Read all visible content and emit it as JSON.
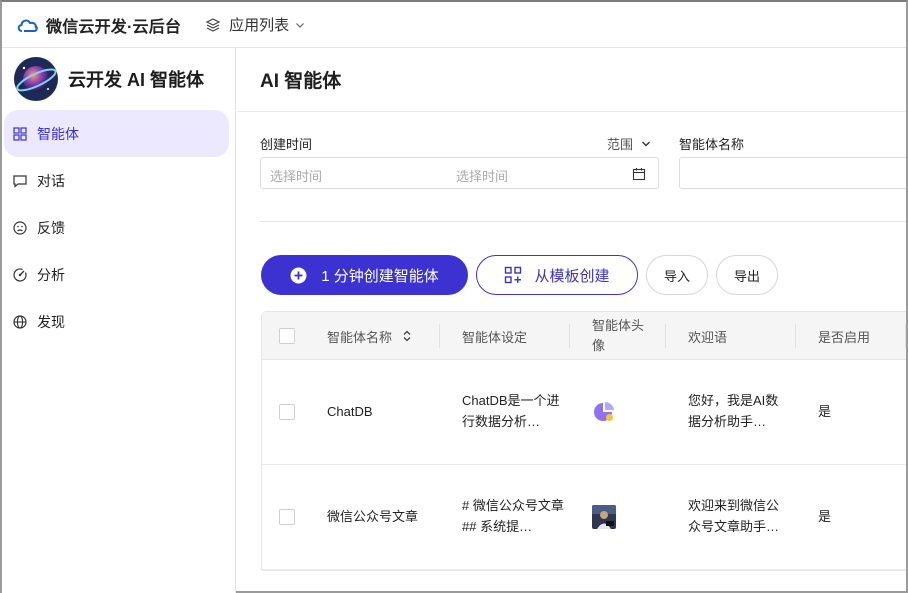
{
  "topbar": {
    "brand": "微信云开发·云后台",
    "app_list": "应用列表"
  },
  "sidebar": {
    "title": "云开发 AI 智能体",
    "items": [
      {
        "label": "智能体",
        "icon": "grid-icon",
        "active": true
      },
      {
        "label": "对话",
        "icon": "chat-icon",
        "active": false
      },
      {
        "label": "反馈",
        "icon": "sad-face-icon",
        "active": false
      },
      {
        "label": "分析",
        "icon": "gauge-icon",
        "active": false
      },
      {
        "label": "发现",
        "icon": "globe-icon",
        "active": false
      }
    ]
  },
  "main": {
    "title": "AI 智能体",
    "filters": {
      "created_label": "创建时间",
      "range_label": "范围",
      "start_placeholder": "选择时间",
      "end_placeholder": "选择时间",
      "name_label": "智能体名称"
    },
    "actions": {
      "create": "1 分钟创建智能体",
      "from_template": "从模板创建",
      "import": "导入",
      "export": "导出"
    },
    "table": {
      "columns": [
        "智能体名称",
        "智能体设定",
        "智能体头像",
        "欢迎语",
        "是否启用"
      ],
      "rows": [
        {
          "name": "ChatDB",
          "setting": "ChatDB是一个进行数据分析…",
          "avatar": "pie-chart-icon",
          "welcome": "您好，我是AI数据分析助手…",
          "enabled": "是"
        },
        {
          "name": "微信公众号文章",
          "setting": "# 微信公众号文章 ## 系统提…",
          "avatar": "photo-avatar",
          "welcome": "欢迎来到微信公众号文章助手…",
          "enabled": "是"
        }
      ]
    }
  },
  "colors": {
    "accent": "#3b32d1",
    "active_bg": "#ece9ff"
  }
}
